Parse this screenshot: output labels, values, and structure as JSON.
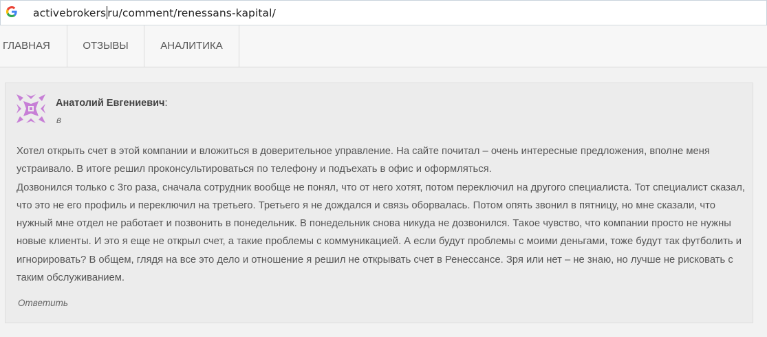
{
  "browser": {
    "url_part1": "activebrokers",
    "url_part2": "ru/comment/renessans-kapital/",
    "search_engine_icon": "google-g-icon"
  },
  "nav": {
    "items": [
      {
        "label": "ГЛАВНАЯ"
      },
      {
        "label": "ОТЗЫВЫ"
      },
      {
        "label": "АНАЛИТИКА"
      }
    ]
  },
  "comment": {
    "avatar_icon": "identicon-avatar",
    "avatar_color": "#c77fd6",
    "author": "Анатолий Евгениевич",
    "author_suffix": ":",
    "subtitle": "в",
    "paragraph1": "Хотел открыть счет в этой компании и вложиться в доверительное управление. На сайте почитал – очень интересные предложения, вполне меня устраивало. В итоге решил проконсультироваться по телефону и подъехать в офис и оформляться.",
    "paragraph2": "Дозвонился только с 3го раза, сначала сотрудник вообще не понял, что от него хотят, потом переключил на другого специалиста. Тот специалист сказал, что это не его профиль и переключил на третьего. Третьего я не дождался и связь оборвалась. Потом опять звонил в пятницу, но мне сказали, что нужный мне отдел не работает и позвонить в понедельник. В понедельник снова никуда не дозвонился. Такое чувство, что компании просто не нужны новые клиенты. И это я еще не открыл счет, а такие проблемы с коммуникацией. А если будут проблемы с моими деньгами, тоже будут так футболить и игнорировать? В общем, глядя на все это дело и отношение я решил не открывать счет в Ренессансе. Зря или нет – не знаю, но лучше не рисковать с таким обслуживанием.",
    "reply_label": "Ответить"
  }
}
